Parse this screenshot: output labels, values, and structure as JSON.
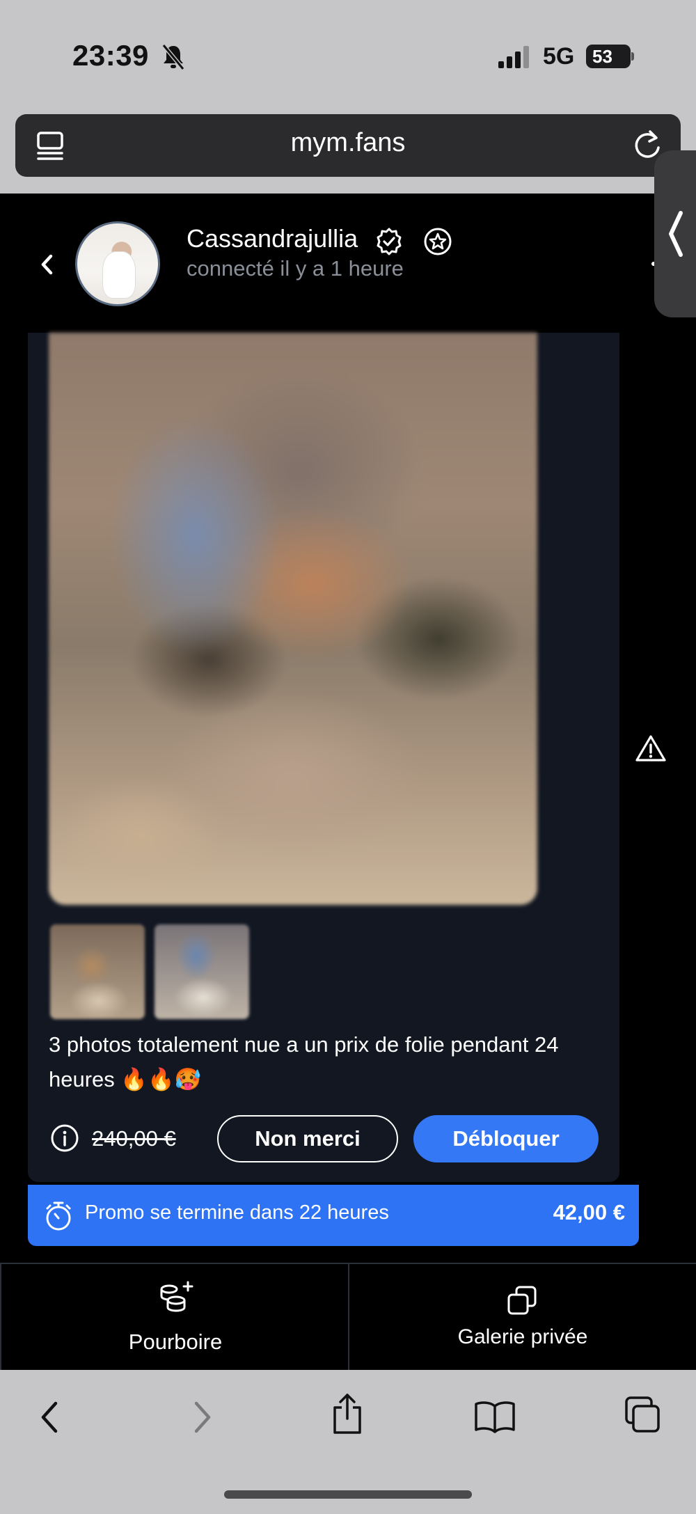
{
  "status_bar": {
    "time": "23:39",
    "network": "5G",
    "battery": "53"
  },
  "browser": {
    "url": "mym.fans"
  },
  "chat_header": {
    "username": "Cassandrajullia",
    "last_seen": "connecté il y a 1 heure"
  },
  "message": {
    "caption": "3 photos totalement nue a un prix de folie pendant 24 heures 🔥🔥🥵",
    "old_price": "240,00 €",
    "decline_label": "Non merci",
    "unlock_label": "Débloquer"
  },
  "promo": {
    "text": "Promo se termine dans 22 heures",
    "price": "42,00 €"
  },
  "bottom_tabs": {
    "tip_label": "Pourboire",
    "gallery_label": "Galerie privée"
  },
  "colors": {
    "accent": "#3478f6",
    "card_bg": "#121722",
    "muted_text": "#8a8f99"
  }
}
